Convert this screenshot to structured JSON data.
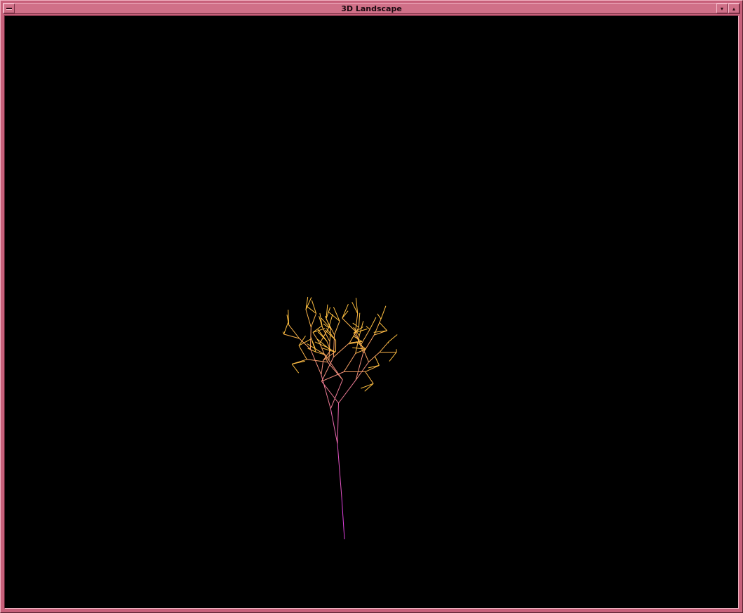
{
  "window": {
    "title": "3D Landscape",
    "menu_glyph": "",
    "minimize_glyph": "▾",
    "maximize_glyph": "▴"
  },
  "colors": {
    "frame": "#c7607a",
    "background": "#000000",
    "trunk": "#e040e0",
    "tips": "#ffc040"
  },
  "scene": {
    "type": "fractal-tree-wireframe",
    "depth": 7,
    "branches": 2
  }
}
